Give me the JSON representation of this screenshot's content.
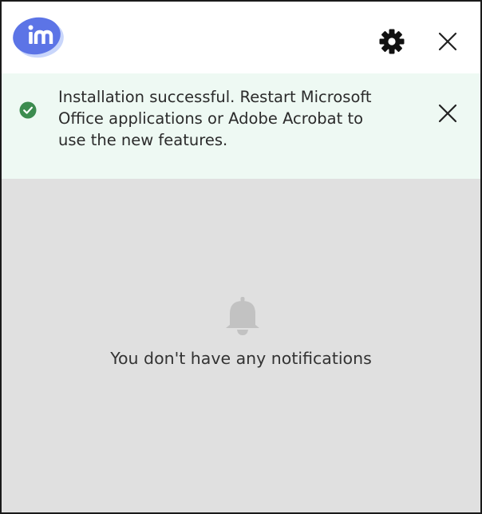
{
  "app": {
    "logo_icon": "imanage-logo",
    "colors": {
      "brand": "#5c74e6",
      "success": "#3c8c4f",
      "banner_background": "#eef9f3",
      "content_background": "#e0e0e0"
    }
  },
  "header": {
    "settings_icon": "gear-icon",
    "close_icon": "close-icon"
  },
  "notification_banner": {
    "status_icon": "check-circle-icon",
    "message_lines": [
      "Installation successful. Restart Microsoft",
      "Office applications or Adobe Acrobat to",
      "use the new features."
    ],
    "dismiss_icon": "close-icon"
  },
  "empty_state": {
    "icon": "bell-icon",
    "message": "You don't have any notifications"
  }
}
